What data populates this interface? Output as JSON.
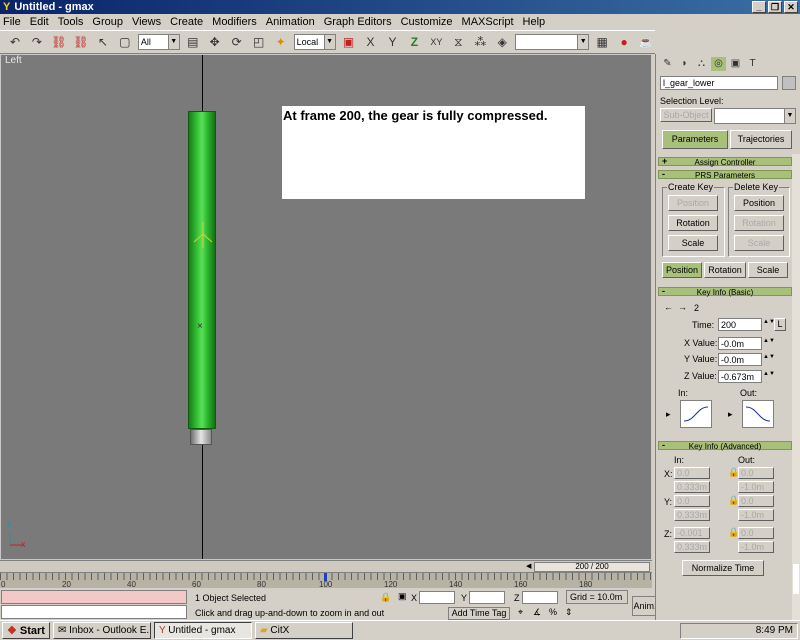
{
  "window": {
    "title": "Untitled - gmax"
  },
  "menu": [
    "File",
    "Edit",
    "Tools",
    "Group",
    "Views",
    "Create",
    "Modifiers",
    "Animation",
    "Graph Editors",
    "Customize",
    "MAXScript",
    "Help"
  ],
  "toolbar": {
    "selection_filter": "All",
    "coord_system": "Local"
  },
  "viewport": {
    "label": "Left",
    "note": "At frame 200, the gear is fully compressed.",
    "axis_z": "z",
    "axis_x": "x"
  },
  "time_slider": {
    "value": "200 / 200"
  },
  "ruler": {
    "ticks": [
      "0",
      "20",
      "40",
      "60",
      "80",
      "100",
      "120",
      "140",
      "160",
      "180"
    ]
  },
  "status": {
    "selection": "1 Object Selected",
    "prompt": "Click and drag up-and-down to zoom in and out",
    "x_label": "X",
    "y_label": "Y",
    "z_label": "Z",
    "grid": "Grid = 10.0m",
    "add_time_tag": "Add Time Tag",
    "anim": "Anim.",
    "frame": "200"
  },
  "panel": {
    "object_name": "l_gear_lower",
    "selection_level_label": "Selection Level:",
    "sub_object": "Sub-Object",
    "tab_parameters": "Parameters",
    "tab_trajectories": "Trajectories",
    "rollup_assign": "Assign Controller",
    "rollup_prs": "PRS Parameters",
    "create_key": "Create Key",
    "delete_key": "Delete Key",
    "position": "Position",
    "rotation": "Rotation",
    "scale": "Scale",
    "rollup_key_basic": "Key Info (Basic)",
    "key_number": "2",
    "time_label": "Time:",
    "time_value": "200",
    "lock_label": "L",
    "xvalue_label": "X Value:",
    "xvalue": "-0.0m",
    "yvalue_label": "Y Value:",
    "yvalue": "-0.0m",
    "zvalue_label": "Z Value:",
    "zvalue": "-0.673m",
    "in_label": "In:",
    "out_label": "Out:",
    "rollup_key_adv": "Key Info (Advanced)",
    "adv_in": "In:",
    "adv_out": "Out:",
    "x_axis": "X:",
    "y_axis": "Y:",
    "z_axis": "Z:",
    "x_in": "0.0",
    "x_in2": "0.333m",
    "x_out": "0.0",
    "x_out2": "-1.0m",
    "y_in": "0.0",
    "y_in2": "0.333m",
    "y_out": "0.0",
    "y_out2": "-1.0m",
    "z_in": "-0.001",
    "z_in2": "0.333m",
    "z_out": "0.0",
    "z_out2": "-1.0m",
    "normalize_time": "Normalize Time"
  },
  "taskbar": {
    "start": "Start",
    "tasks": [
      "Inbox - Outlook E...",
      "Untitled - gmax",
      "CitX"
    ],
    "clock": "8:49 PM"
  }
}
